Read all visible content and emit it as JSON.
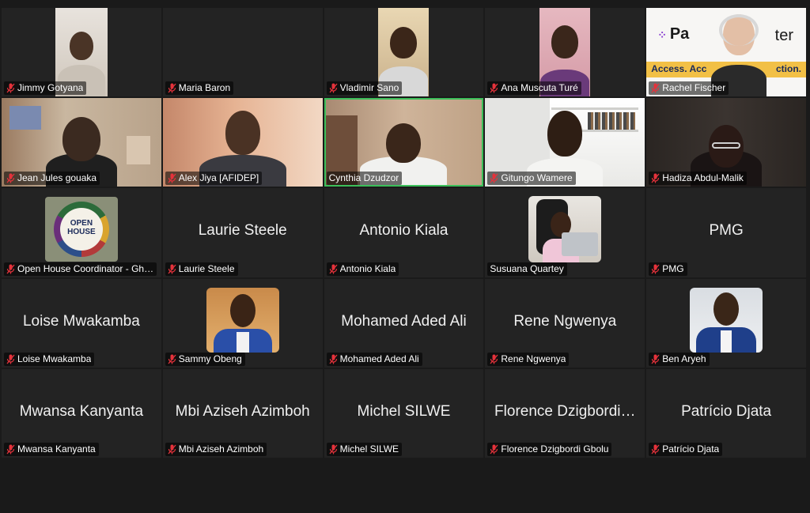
{
  "participants": [
    {
      "name": "Jimmy Gotyana",
      "muted": true,
      "mode": "video"
    },
    {
      "name": "Maria Baron",
      "muted": true,
      "mode": "blank"
    },
    {
      "name": "Vladimir Sano",
      "muted": true,
      "mode": "video"
    },
    {
      "name": "Ana Muscuta Turé",
      "muted": true,
      "mode": "video"
    },
    {
      "name": "Rachel Fischer",
      "muted": true,
      "mode": "video"
    },
    {
      "name": "Jean Jules gouaka",
      "muted": true,
      "mode": "video"
    },
    {
      "name": "Alex Jiya [AFIDEP]",
      "muted": true,
      "mode": "video"
    },
    {
      "name": "Cynthia Dzudzor",
      "muted": false,
      "mode": "video",
      "active_speaker": true
    },
    {
      "name": "Gitungo Wamere",
      "muted": true,
      "mode": "video"
    },
    {
      "name": "Hadiza Abdul-Malik",
      "muted": true,
      "mode": "video"
    },
    {
      "name": "Open House Coordinator - Gh…",
      "muted": true,
      "mode": "avatar"
    },
    {
      "name": "Laurie Steele",
      "muted": true,
      "mode": "name",
      "display": "Laurie Steele"
    },
    {
      "name": "Antonio Kiala",
      "muted": true,
      "mode": "name",
      "display": "Antonio Kiala"
    },
    {
      "name": "Susuana Quartey",
      "muted": false,
      "mode": "avatar"
    },
    {
      "name": "PMG",
      "muted": true,
      "mode": "name",
      "display": "PMG"
    },
    {
      "name": "Loise Mwakamba",
      "muted": true,
      "mode": "name",
      "display": "Loise Mwakamba"
    },
    {
      "name": "Sammy Obeng",
      "muted": true,
      "mode": "avatar"
    },
    {
      "name": "Mohamed Aded Ali",
      "muted": true,
      "mode": "name",
      "display": "Mohamed Aded Ali"
    },
    {
      "name": "Rene Ngwenya",
      "muted": true,
      "mode": "name",
      "display": "Rene Ngwenya"
    },
    {
      "name": "Ben Aryeh",
      "muted": true,
      "mode": "avatar"
    },
    {
      "name": "Mwansa Kanyanta",
      "muted": true,
      "mode": "name",
      "display": "Mwansa Kanyanta"
    },
    {
      "name": "Mbi Aziseh Azimboh",
      "muted": true,
      "mode": "name",
      "display": "Mbi Aziseh Azimboh"
    },
    {
      "name": "Michel SILWE",
      "muted": true,
      "mode": "name",
      "display": "Michel SILWE"
    },
    {
      "name": "Florence Dzigbordi Gbolu",
      "muted": true,
      "mode": "name",
      "display": "Florence Dzigbordi…"
    },
    {
      "name": "Patrício Djata",
      "muted": true,
      "mode": "name",
      "display": "Patrício Djata"
    }
  ],
  "logo": {
    "line1": "OPEN",
    "line2": "HOUSE"
  },
  "banner": {
    "brand_partial": "Pa",
    "brand_suffix": "ter",
    "tagline": "Access. Acc",
    "tagline_end": "ction."
  },
  "colors": {
    "muted_icon": "#e5323b",
    "active_border": "#3cbf5a",
    "tile_bg": "#232323",
    "page_bg": "#1a1a1a"
  }
}
